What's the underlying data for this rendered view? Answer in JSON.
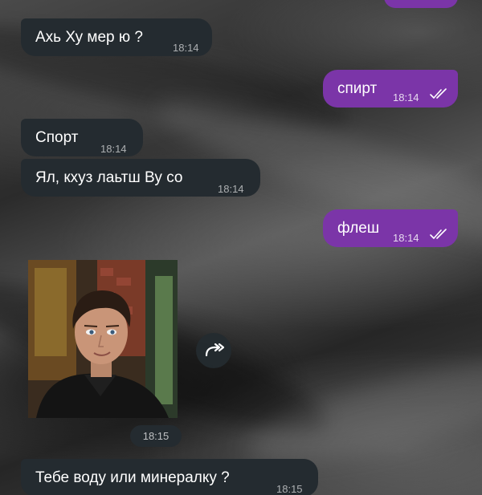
{
  "chat": {
    "messages": [
      {
        "direction": "in",
        "text": "Ахь Ху мер ю ?",
        "time": "18:14"
      },
      {
        "direction": "out",
        "text": "спирт",
        "time": "18:14",
        "status": "read"
      },
      {
        "direction": "in",
        "text": "Спорт",
        "time": "18:14"
      },
      {
        "direction": "in",
        "text": "Ял, кхуз лаьтш Ву со",
        "time": "18:14"
      },
      {
        "direction": "out",
        "text": "флеш",
        "time": "18:14",
        "status": "read"
      },
      {
        "direction": "in",
        "type": "photo",
        "time": "18:15"
      },
      {
        "direction": "in",
        "text": "Тебе воду или минералку ?",
        "time": "18:15"
      }
    ]
  },
  "colors": {
    "incoming_bubble": "#242b30",
    "outgoing_bubble": "#7b35a8",
    "read_check": "#ffffff"
  },
  "icons": {
    "read_status": "double-check-icon",
    "forward": "forward-arrow-icon"
  }
}
